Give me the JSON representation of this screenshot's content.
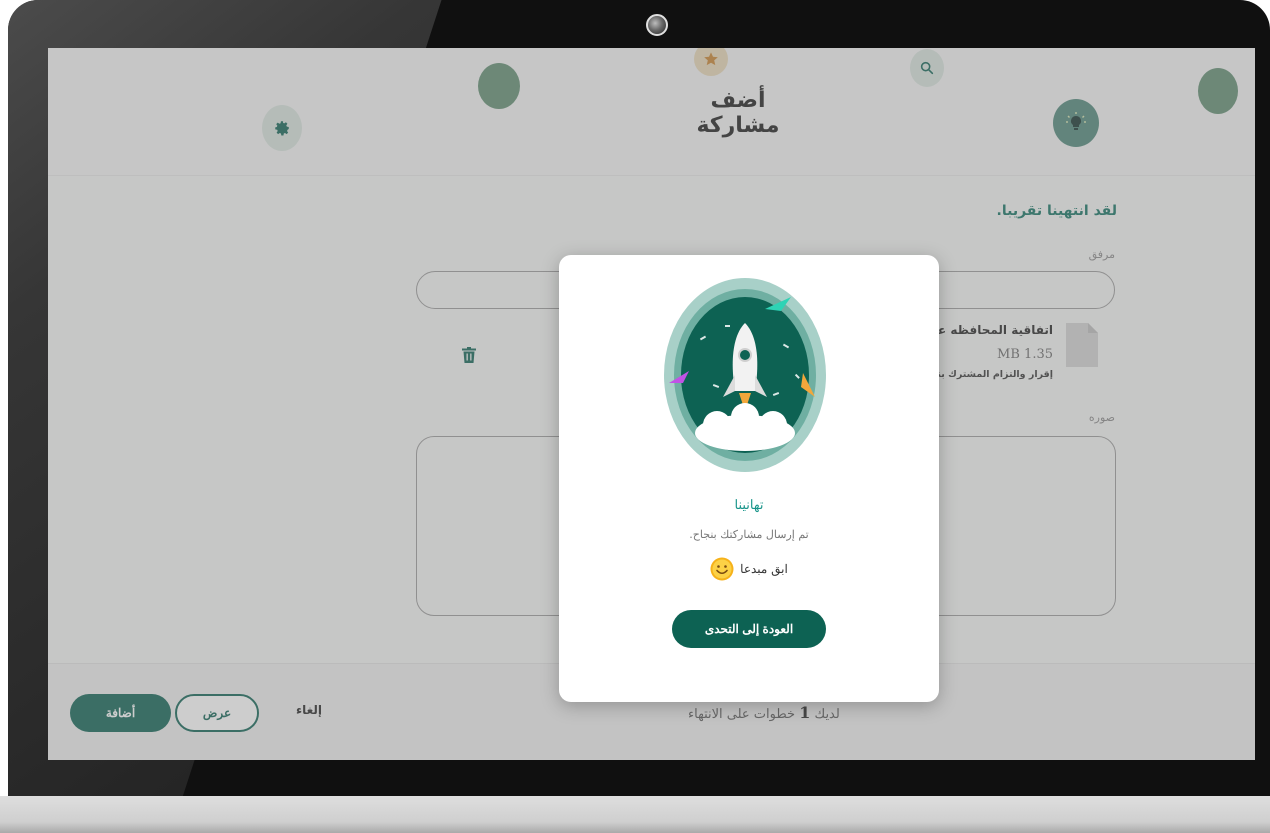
{
  "header": {
    "title": "أضف مشاركة"
  },
  "form": {
    "section_title": "لقد انتهينا تقريبا.",
    "attachment_label": "مرفق",
    "attachment": {
      "name": "اتفاقية المحافظه على السر",
      "size": "MB 1.35",
      "description": "إقرار والتزام المشترك بنتائج ا"
    },
    "image_label": "صوره"
  },
  "footer": {
    "add_label": "أضافة",
    "view_label": "عرض",
    "cancel_label": "إلغاء",
    "steps_prefix": "لديك",
    "steps_count": "1",
    "steps_suffix": "خطوات على الانتهاء"
  },
  "modal": {
    "congrats": "تهانينا",
    "message": "تم إرسال مشاركتك بنجاح.",
    "keep_creative": "ابق مبدعا",
    "back_label": "العودة إلى التحدى"
  },
  "colors": {
    "primary": "#0d6253",
    "accent_teal": "#19958a",
    "avatar": "#5f8d71"
  },
  "icons": [
    "gear-icon",
    "star-icon",
    "search-icon",
    "lightbulb-icon",
    "file-icon",
    "trash-icon",
    "rocket-icon",
    "smiley-icon"
  ]
}
